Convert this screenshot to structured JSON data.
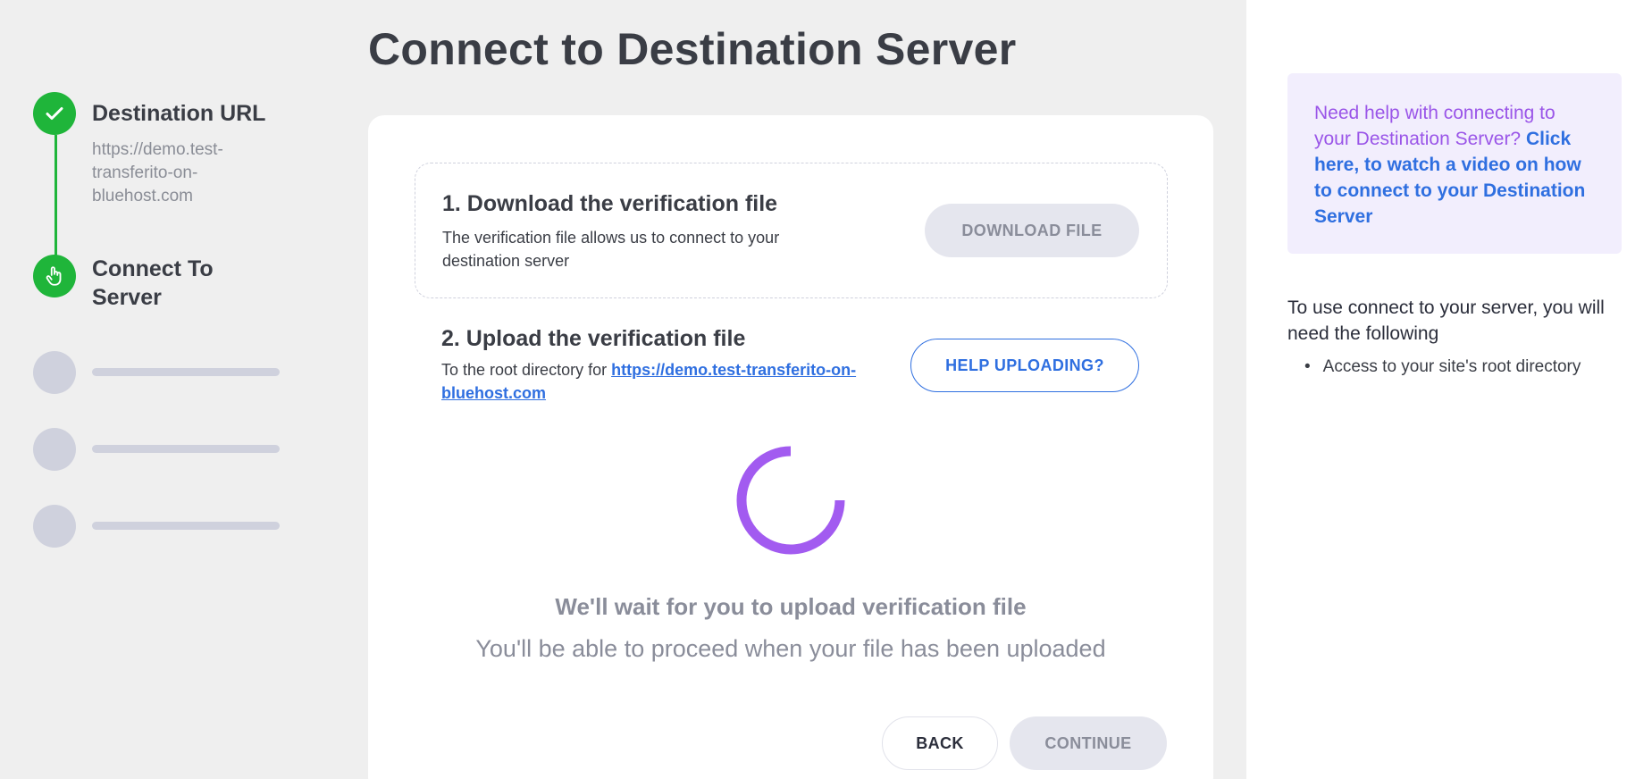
{
  "page": {
    "title": "Connect to Destination Server"
  },
  "stepper": {
    "steps": [
      {
        "title": "Destination URL",
        "subtitle": "https://demo.test-transferito-on-bluehost.com",
        "state": "done",
        "icon": "check-icon"
      },
      {
        "title": "Connect To Server",
        "state": "active",
        "icon": "hand-pointer-icon"
      },
      {
        "state": "pending"
      },
      {
        "state": "pending"
      },
      {
        "state": "pending"
      }
    ]
  },
  "download": {
    "title": "1. Download the verification file",
    "description": "The verification file allows us to connect to your destination server",
    "button_label": "DOWNLOAD FILE"
  },
  "upload": {
    "title": "2. Upload the verification file",
    "description_prefix": "To the root directory for ",
    "link_text": "https://demo.test-transferito-on-bluehost.com",
    "help_button_label": "HELP UPLOADING?"
  },
  "status": {
    "title": "We'll wait for you to upload verification file",
    "subtitle": "You'll be able to proceed when your file has been uploaded"
  },
  "footer": {
    "back_label": "BACK",
    "continue_label": "CONTINUE"
  },
  "sidebar": {
    "help_question": "Need help with connecting to your Destination Server?",
    "help_link": "Click here, to watch a video on how to connect to your Destination Server",
    "requirements_intro": "To use connect to your server, you will need the following",
    "requirements": [
      "Access to your site's root directory"
    ]
  },
  "colors": {
    "success": "#1fb53a",
    "pending": "#cfd1dd",
    "link": "#2f6fe0",
    "spinner": "#a25bf0",
    "help_box_bg": "#f2eefd",
    "help_question": "#9a55e8"
  }
}
